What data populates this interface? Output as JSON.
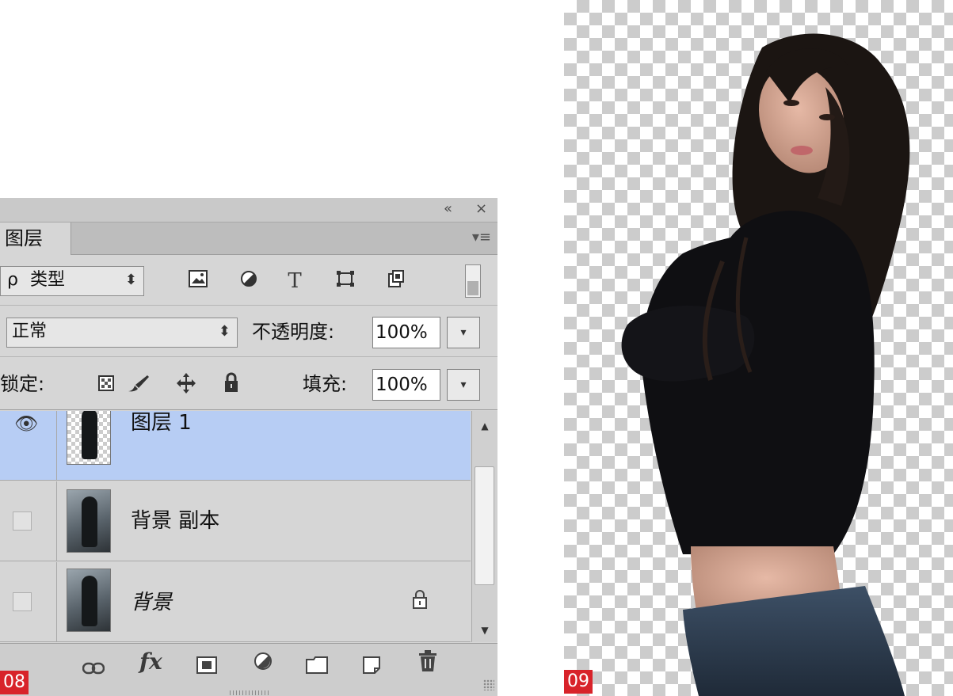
{
  "panel": {
    "tab_label": "图层",
    "collapse_icon": "double-chevron-icon",
    "close_icon": "close-icon",
    "menu_icon": "panel-menu-icon",
    "filter": {
      "search_glyph": "ρ",
      "kind_label": "类型",
      "icons": [
        "image-filter-icon",
        "adjustment-filter-icon",
        "type-filter-icon",
        "shape-filter-icon",
        "smart-object-filter-icon"
      ]
    },
    "blend_mode": "正常",
    "opacity_label": "不透明度:",
    "opacity_value": "100%",
    "lock_label": "锁定:",
    "lock_icons": [
      "lock-transparency-icon",
      "lock-pixels-icon",
      "lock-position-icon",
      "lock-all-icon"
    ],
    "fill_label": "填充:",
    "fill_value": "100%",
    "layers": [
      {
        "name": "图层 1",
        "selected": true,
        "visible": true,
        "transparent": true
      },
      {
        "name": "背景 副本",
        "selected": false,
        "visible": false
      },
      {
        "name": "背景",
        "selected": false,
        "visible": false,
        "locked": true,
        "italic": true
      }
    ],
    "bottom_icons": [
      "link-layers-icon",
      "fx-icon",
      "mask-icon",
      "adjustment-layer-icon",
      "group-folder-icon",
      "new-layer-icon",
      "trash-icon"
    ],
    "fx_label": "fx",
    "step_label": "08"
  },
  "canvas": {
    "step_label": "09",
    "accent_color": "#d8232a",
    "selection_color": "#b7cdf4"
  }
}
